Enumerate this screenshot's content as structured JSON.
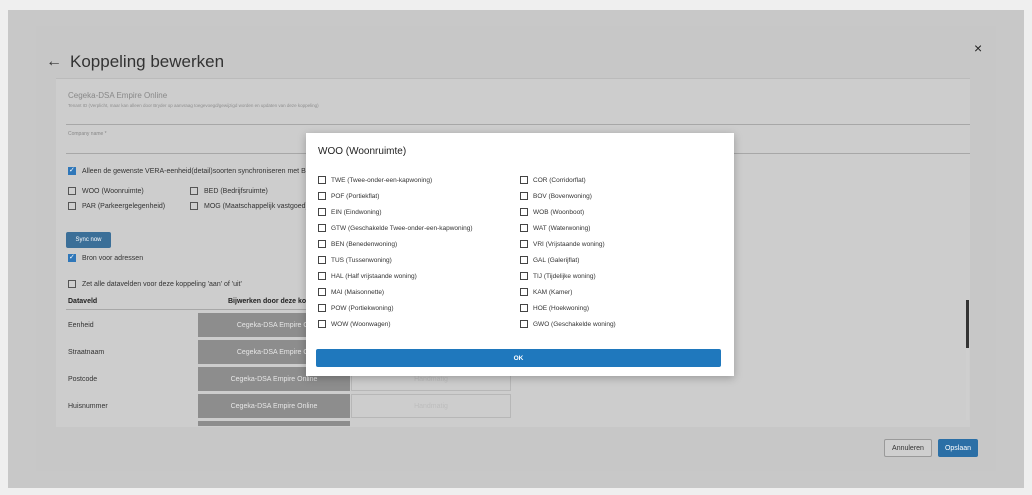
{
  "header": {
    "back_icon": "arrow-left-icon",
    "title": "Koppeling bewerken",
    "close": "×"
  },
  "connection": {
    "name": "Cegeka-DSA Empire Online",
    "tenant_note": "Tenant ID (Verplicht, maar kan alleen door Bryder op aanvraag toegevoegd/gewijzigd worden en updaten van deze koppeling)",
    "company_label": "Company name *"
  },
  "sync_options": {
    "vera_label": "Alleen de gewenste VERA-eenheid(detail)soorten synchroniseren met Bry",
    "types": [
      {
        "label": "WOO (Woonruimte)"
      },
      {
        "label": "BED (Bedrijfsruimte)"
      },
      {
        "label": "PAR (Parkeergelegenheid)"
      },
      {
        "label": "MOG (Maatschappelijk vastgoed)"
      }
    ],
    "sync_button": "Sync now",
    "source_label": "Bron voor adressen",
    "toggle_all_label": "Zet alle datavelden voor deze koppeling 'aan' of 'uit'"
  },
  "table": {
    "headers": [
      "Dataveld",
      "Bijwerken door deze kopp"
    ],
    "rows": [
      {
        "field": "Eenheid",
        "a": "Cegeka-DSA Empire Or",
        "b": ""
      },
      {
        "field": "Straatnaam",
        "a": "Cegeka-DSA Empire Or",
        "b": ""
      },
      {
        "field": "Postcode",
        "a": "Cegeka-DSA Empire Online",
        "b": "Handmatig"
      },
      {
        "field": "Huisnummer",
        "a": "Cegeka-DSA Empire Online",
        "b": "Handmatig"
      }
    ]
  },
  "footer": {
    "cancel": "Annuleren",
    "save": "Opslaan"
  },
  "modal": {
    "title": "WOO (Woonruimte)",
    "left_options": [
      "TWE (Twee-onder-een-kapwoning)",
      "POF (Portiekflat)",
      "EIN (Eindwoning)",
      "GTW (Geschakelde Twee-onder-een-kapwoning)",
      "BEN (Benedenwoning)",
      "TUS (Tussenwoning)",
      "HAL (Half vrijstaande woning)",
      "MAI (Maisonnette)",
      "POW (Portiekwoning)",
      "WOW (Woonwagen)"
    ],
    "right_options": [
      "COR (Corridorflat)",
      "BOV (Bovenwoning)",
      "WOB (Woonboot)",
      "WAT (Waterwoning)",
      "VRI (Vrijstaande woning)",
      "GAL (Galerijflat)",
      "TIJ (Tijdelijke woning)",
      "KAM (Kamer)",
      "HOE (Hoekwoning)",
      "GWO (Geschakelde woning)"
    ],
    "ok": "OK"
  }
}
